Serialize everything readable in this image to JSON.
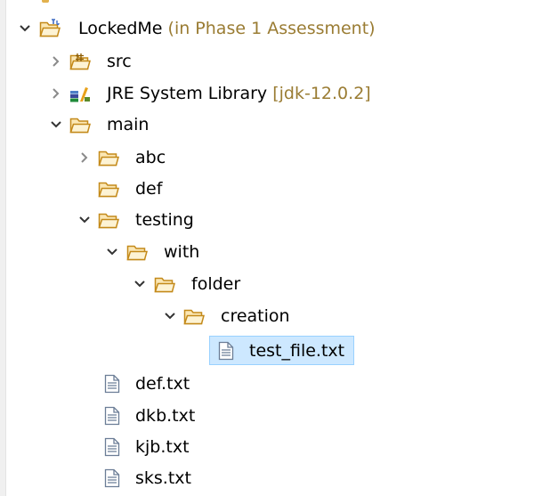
{
  "tree": {
    "project": {
      "label": "LockedMe",
      "decoration": "(in Phase 1 Assessment)"
    },
    "src": {
      "label": "src"
    },
    "jre": {
      "label": "JRE System Library",
      "decoration": "[jdk-12.0.2]"
    },
    "main": {
      "label": "main"
    },
    "abc": {
      "label": "abc"
    },
    "def": {
      "label": "def"
    },
    "testing": {
      "label": "testing"
    },
    "with": {
      "label": "with"
    },
    "folder": {
      "label": "folder"
    },
    "creation": {
      "label": "creation"
    },
    "test_file": {
      "label": "test_file.txt"
    },
    "def_txt": {
      "label": "def.txt"
    },
    "dkb_txt": {
      "label": "dkb.txt"
    },
    "kjb_txt": {
      "label": "kjb.txt"
    },
    "sks_txt": {
      "label": "sks.txt"
    }
  },
  "colors": {
    "selection_bg": "#cde8ff",
    "selection_border": "#99d1ff",
    "decoration_text": "#9a7c33",
    "folder_stroke": "#c48a1a",
    "folder_fill": "#fbe7b4"
  }
}
